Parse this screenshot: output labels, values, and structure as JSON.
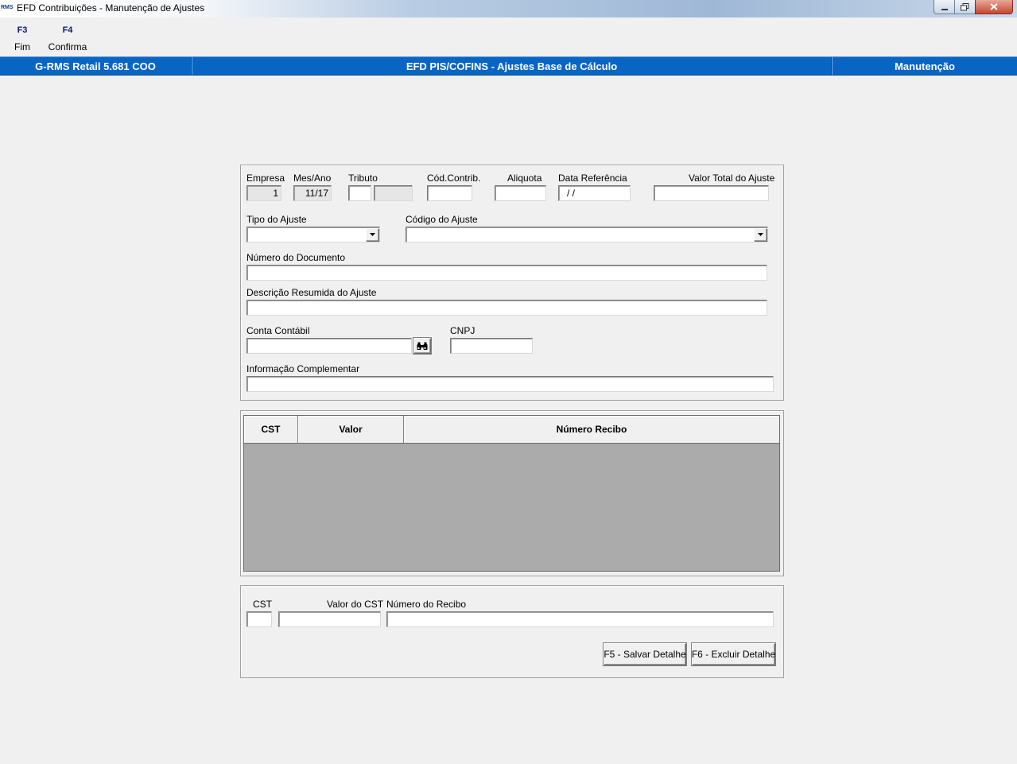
{
  "window": {
    "logo": "RMS",
    "title": "EFD Contribuições - Manutenção de Ajustes"
  },
  "fkeys": [
    {
      "key": "F3",
      "label": "Fim"
    },
    {
      "key": "F4",
      "label": "Confirma"
    }
  ],
  "header": {
    "left": "G-RMS Retail 5.681 COO",
    "center": "EFD PIS/COFINS - Ajustes Base de Cálculo",
    "right": "Manutenção"
  },
  "form": {
    "empresa": {
      "label": "Empresa",
      "value": "1"
    },
    "mes_ano": {
      "label": "Mes/Ano",
      "value": "11/17"
    },
    "tributo": {
      "label": "Tributo",
      "value": "",
      "desc": ""
    },
    "cod_contrib": {
      "label": "Cód.Contrib.",
      "value": ""
    },
    "aliquota": {
      "label": "Aliquota",
      "value": ""
    },
    "data_referencia": {
      "label": "Data Referência",
      "value": " /  /"
    },
    "valor_total": {
      "label": "Valor Total do Ajuste",
      "value": ""
    },
    "tipo_ajuste": {
      "label": "Tipo do Ajuste",
      "value": ""
    },
    "codigo_ajuste": {
      "label": "Código do Ajuste",
      "value": ""
    },
    "numero_documento": {
      "label": "Número do Documento",
      "value": ""
    },
    "descricao": {
      "label": "Descrição Resumida do Ajuste",
      "value": ""
    },
    "conta_contabil": {
      "label": "Conta Contábil",
      "value": ""
    },
    "cnpj": {
      "label": "CNPJ",
      "value": ""
    },
    "info_complementar": {
      "label": "Informação Complementar",
      "value": ""
    }
  },
  "grid": {
    "columns": [
      "CST",
      "Valor",
      "Número Recibo"
    ],
    "rows": []
  },
  "detail": {
    "cst": {
      "label": "CST",
      "value": ""
    },
    "valor_cst": {
      "label": "Valor do CST",
      "value": ""
    },
    "numero_recibo": {
      "label": "Número do Recibo",
      "value": ""
    },
    "save_button": "F5 - Salvar Detalhe",
    "delete_button": "F6 - Excluir Detalhe"
  },
  "colors": {
    "header_bg": "#0865c4",
    "fkey_text": "#0a1a70",
    "grid_bg": "#ababab"
  }
}
